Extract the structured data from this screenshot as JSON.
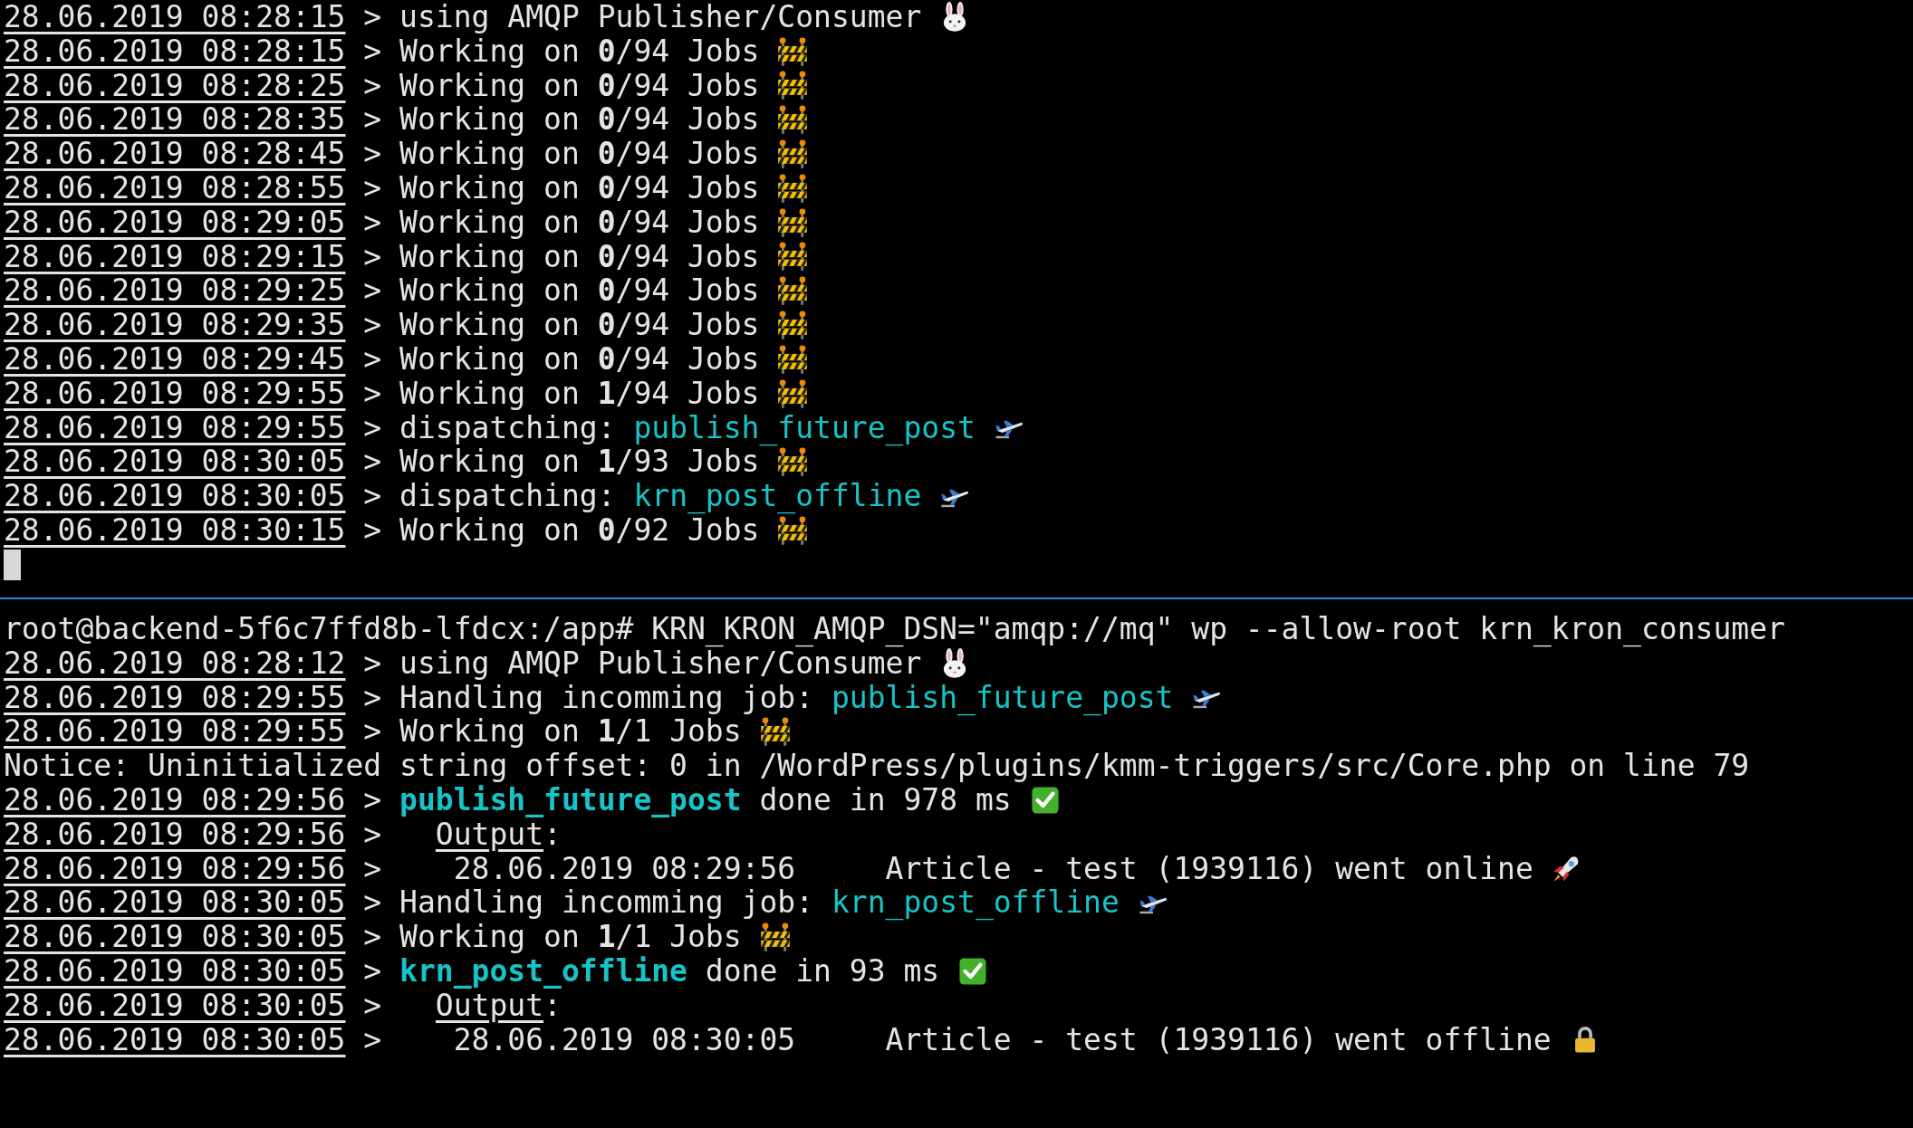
{
  "panes": [
    {
      "cursor": true,
      "lines": [
        {
          "timestamp": "28.06.2019 08:28:15",
          "segments": [
            {
              "kind": "text",
              "text": " > using AMQP Publisher/Consumer"
            }
          ],
          "kind": "rabbit"
        },
        {
          "timestamp": "28.06.2019 08:28:15",
          "segments": [
            {
              "kind": "text",
              "text": " > Working on **0**/94 Jobs"
            }
          ],
          "kind": "barrier"
        },
        {
          "timestamp": "28.06.2019 08:28:25",
          "segments": [
            {
              "kind": "text",
              "text": " > Working on **0**/94 Jobs"
            }
          ],
          "kind": "barrier"
        },
        {
          "timestamp": "28.06.2019 08:28:35",
          "segments": [
            {
              "kind": "text",
              "text": " > Working on **0**/94 Jobs"
            }
          ],
          "kind": "barrier"
        },
        {
          "timestamp": "28.06.2019 08:28:45",
          "segments": [
            {
              "kind": "text",
              "text": " > Working on **0**/94 Jobs"
            }
          ],
          "kind": "barrier"
        },
        {
          "timestamp": "28.06.2019 08:28:55",
          "segments": [
            {
              "kind": "text",
              "text": " > Working on **0**/94 Jobs"
            }
          ],
          "kind": "barrier"
        },
        {
          "timestamp": "28.06.2019 08:29:05",
          "segments": [
            {
              "kind": "text",
              "text": " > Working on **0**/94 Jobs"
            }
          ],
          "kind": "barrier"
        },
        {
          "timestamp": "28.06.2019 08:29:15",
          "segments": [
            {
              "kind": "text",
              "text": " > Working on **0**/94 Jobs"
            }
          ],
          "kind": "barrier"
        },
        {
          "timestamp": "28.06.2019 08:29:25",
          "segments": [
            {
              "kind": "text",
              "text": " > Working on **0**/94 Jobs"
            }
          ],
          "kind": "barrier"
        },
        {
          "timestamp": "28.06.2019 08:29:35",
          "segments": [
            {
              "kind": "text",
              "text": " > Working on **0**/94 Jobs"
            }
          ],
          "kind": "barrier"
        },
        {
          "timestamp": "28.06.2019 08:29:45",
          "segments": [
            {
              "kind": "text",
              "text": " > Working on **0**/94 Jobs"
            }
          ],
          "kind": "barrier"
        },
        {
          "timestamp": "28.06.2019 08:29:55",
          "segments": [
            {
              "kind": "text",
              "text": " > Working on **1**/94 Jobs"
            }
          ],
          "kind": "barrier"
        },
        {
          "timestamp": "28.06.2019 08:29:55",
          "segments": [
            {
              "kind": "text",
              "text": " > dispatching: "
            },
            {
              "kind": "job",
              "text": "publish_future_post"
            }
          ],
          "kind": "plane"
        },
        {
          "timestamp": "28.06.2019 08:30:05",
          "segments": [
            {
              "kind": "text",
              "text": " > Working on **1**/93 Jobs"
            }
          ],
          "kind": "barrier"
        },
        {
          "timestamp": "28.06.2019 08:30:05",
          "segments": [
            {
              "kind": "text",
              "text": " > dispatching: "
            },
            {
              "kind": "job",
              "text": "krn_post_offline"
            }
          ],
          "kind": "plane"
        },
        {
          "timestamp": "28.06.2019 08:30:15",
          "segments": [
            {
              "kind": "text",
              "text": " > Working on **0**/92 Jobs"
            }
          ],
          "kind": "barrier"
        }
      ]
    },
    {
      "lines": [
        {
          "segments": [
            {
              "kind": "text",
              "text": "root@backend-5f6c7ffd8b-lfdcx:/app# KRN_KRON_AMQP_DSN=\"amqp://mq\" wp --allow-root krn_kron_consumer"
            }
          ]
        },
        {
          "timestamp": "28.06.2019 08:28:12",
          "segments": [
            {
              "kind": "text",
              "text": " > using AMQP Publisher/Consumer"
            }
          ],
          "kind": "rabbit"
        },
        {
          "timestamp": "28.06.2019 08:29:55",
          "segments": [
            {
              "kind": "text",
              "text": " > Handling incomming job: "
            },
            {
              "kind": "job",
              "text": "publish_future_post"
            }
          ],
          "kind": "plane"
        },
        {
          "timestamp": "28.06.2019 08:29:55",
          "segments": [
            {
              "kind": "text",
              "text": " > Working on **1**/1 Jobs"
            }
          ],
          "kind": "barrier"
        },
        {
          "segments": [
            {
              "kind": "text",
              "text": "Notice: Uninitialized string offset: 0 in /WordPress/plugins/kmm-triggers/src/Core.php on line 79"
            }
          ]
        },
        {
          "timestamp": "28.06.2019 08:29:56",
          "segments": [
            {
              "kind": "text",
              "text": " > "
            },
            {
              "kind": "job_bold",
              "text": "publish_future_post"
            },
            {
              "kind": "text",
              "text": " done in 978 ms"
            }
          ],
          "kind": "check"
        },
        {
          "timestamp": "28.06.2019 08:29:56",
          "segments": [
            {
              "kind": "text",
              "text": " >   "
            },
            {
              "kind": "underline",
              "text": "Output"
            },
            {
              "kind": "text",
              "text": ":"
            }
          ]
        },
        {
          "timestamp": "28.06.2019 08:29:56",
          "segments": [
            {
              "kind": "text",
              "text": " >    28.06.2019 08:29:56     Article - test (1939116) went online"
            }
          ],
          "kind": "rocket"
        },
        {
          "timestamp": "28.06.2019 08:30:05",
          "segments": [
            {
              "kind": "text",
              "text": " > Handling incomming job: "
            },
            {
              "kind": "job",
              "text": "krn_post_offline"
            }
          ],
          "kind": "plane"
        },
        {
          "timestamp": "28.06.2019 08:30:05",
          "segments": [
            {
              "kind": "text",
              "text": " > Working on **1**/1 Jobs"
            }
          ],
          "kind": "barrier"
        },
        {
          "timestamp": "28.06.2019 08:30:05",
          "segments": [
            {
              "kind": "text",
              "text": " > "
            },
            {
              "kind": "job_bold",
              "text": "krn_post_offline"
            },
            {
              "kind": "text",
              "text": " done in 93 ms"
            }
          ],
          "kind": "check"
        },
        {
          "timestamp": "28.06.2019 08:30:05",
          "segments": [
            {
              "kind": "text",
              "text": " >   "
            },
            {
              "kind": "underline",
              "text": "Output"
            },
            {
              "kind": "text",
              "text": ":"
            }
          ]
        },
        {
          "timestamp": "28.06.2019 08:30:05",
          "segments": [
            {
              "kind": "text",
              "text": " >    28.06.2019 08:30:05     Article - test (1939116) went offline"
            }
          ],
          "kind": "lock"
        }
      ]
    }
  ]
}
